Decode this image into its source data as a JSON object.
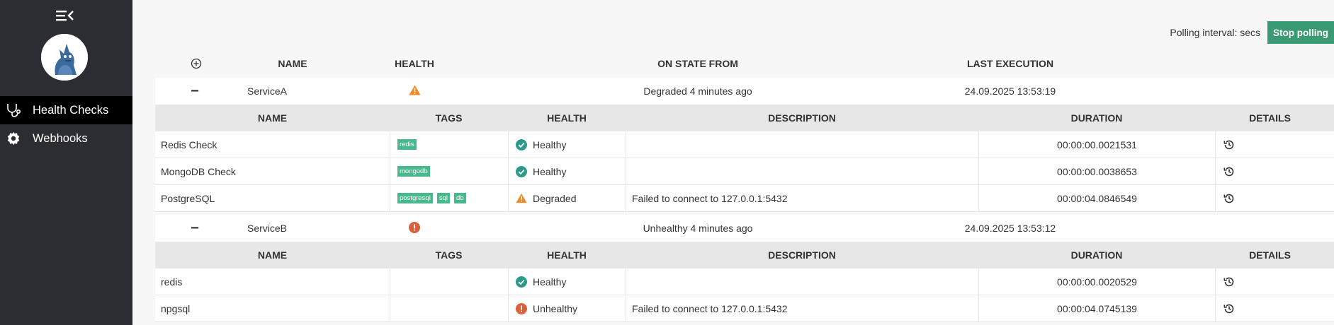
{
  "sidebar": {
    "items": [
      {
        "label": "Health Checks",
        "icon": "stethoscope-icon",
        "active": true
      },
      {
        "label": "Webhooks",
        "icon": "gear-icon",
        "active": false
      }
    ]
  },
  "polling": {
    "text": "Polling interval: secs",
    "button": "Stop polling"
  },
  "table": {
    "headers": {
      "name": "NAME",
      "health": "HEALTH",
      "state": "ON STATE FROM",
      "last": "LAST EXECUTION"
    },
    "detail_headers": {
      "name": "NAME",
      "tags": "TAGS",
      "health": "HEALTH",
      "description": "DESCRIPTION",
      "duration": "DURATION",
      "details": "DETAILS"
    }
  },
  "services": [
    {
      "toggle": "−",
      "name": "ServiceA",
      "health": "warning-icon",
      "state": "Degraded 4 minutes ago",
      "last": "24.09.2025 13:53:19",
      "checks": [
        {
          "name": "Redis Check",
          "tags": [
            "redis"
          ],
          "status": "Healthy",
          "description": "",
          "duration": "00:00:00.0021531"
        },
        {
          "name": "MongoDB Check",
          "tags": [
            "mongodb"
          ],
          "status": "Healthy",
          "description": "",
          "duration": "00:00:00.0038653"
        },
        {
          "name": "PostgreSQL",
          "tags": [
            "postgresql",
            "sql",
            "db"
          ],
          "status": "Degraded",
          "description": "Failed to connect to 127.0.0.1:5432",
          "duration": "00:00:04.0846549"
        }
      ]
    },
    {
      "toggle": "−",
      "name": "ServiceB",
      "health": "error-icon",
      "state": "Unhealthy 4 minutes ago",
      "last": "24.09.2025 13:53:12",
      "checks": [
        {
          "name": "redis",
          "tags": [],
          "status": "Healthy",
          "description": "",
          "duration": "00:00:00.0020529"
        },
        {
          "name": "npgsql",
          "tags": [],
          "status": "Unhealthy",
          "description": "Failed to connect to 127.0.0.1:5432",
          "duration": "00:00:04.0745139"
        }
      ]
    }
  ],
  "colors": {
    "healthy": "#2b9a8a",
    "degraded": "#f08a24",
    "unhealthy": "#d9603a",
    "accent": "#3a9a74",
    "tag": "#48b88d"
  }
}
